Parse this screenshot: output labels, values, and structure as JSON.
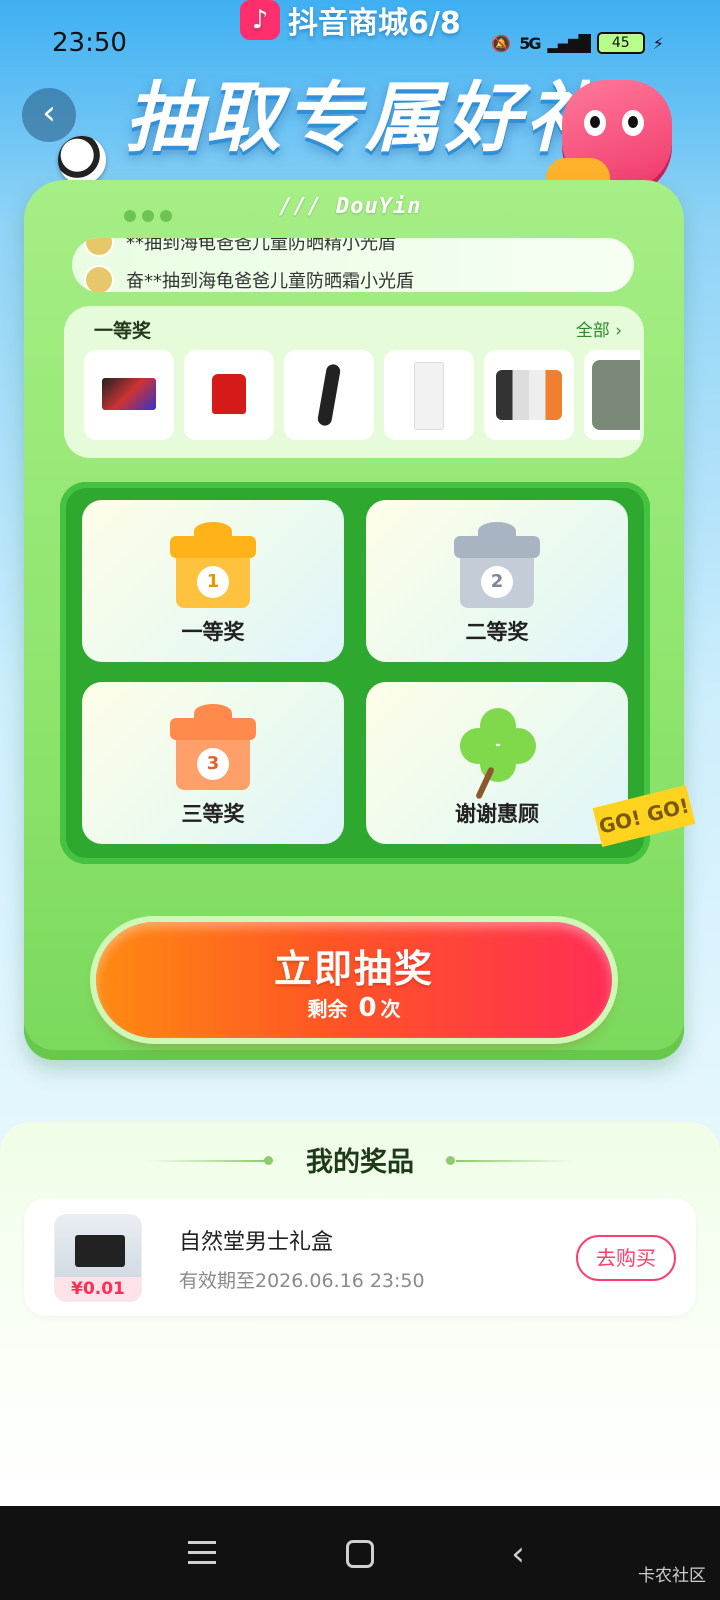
{
  "status_bar": {
    "time": "23:50",
    "network": "5G",
    "battery": "45"
  },
  "app": {
    "logo_text": "抖音商城6/8",
    "back_icon": "chevron-left-icon"
  },
  "banner": {
    "title": "抽取专属好礼"
  },
  "machine": {
    "brand": "/// DouYin",
    "ticker": [
      "**抽到海龟爸爸儿童防晒精小光盾",
      "奋**抽到海龟爸爸儿童防晒霜小光盾"
    ],
    "prize_strip": {
      "title": "一等奖",
      "all_label": "全部",
      "items": [
        "tv-icon",
        "jersey-icon",
        "hairdryer-icon",
        "fridge-icon",
        "phones-icon",
        "sneaker-icon"
      ]
    },
    "grid": [
      {
        "label": "一等奖",
        "num": "1",
        "color": "#ffb21a"
      },
      {
        "label": "二等奖",
        "num": "2",
        "color": "#a9b4c2"
      },
      {
        "label": "三等奖",
        "num": "3",
        "color": "#ff8a4c"
      },
      {
        "label": "谢谢惠顾",
        "num": "",
        "color": "#7fd94b"
      }
    ],
    "go_badge": "GO! GO!",
    "draw_button": {
      "label": "立即抽奖",
      "remaining_prefix": "剩余",
      "remaining": "0",
      "remaining_suffix": "次"
    }
  },
  "my_prizes": {
    "title": "我的奖品",
    "items": [
      {
        "name": "自然堂男士礼盒",
        "valid": "有效期至2026.06.16 23:50",
        "price": "¥0.01",
        "action": "去购买"
      }
    ]
  },
  "navbar": {
    "watermark": "卡农社区"
  }
}
